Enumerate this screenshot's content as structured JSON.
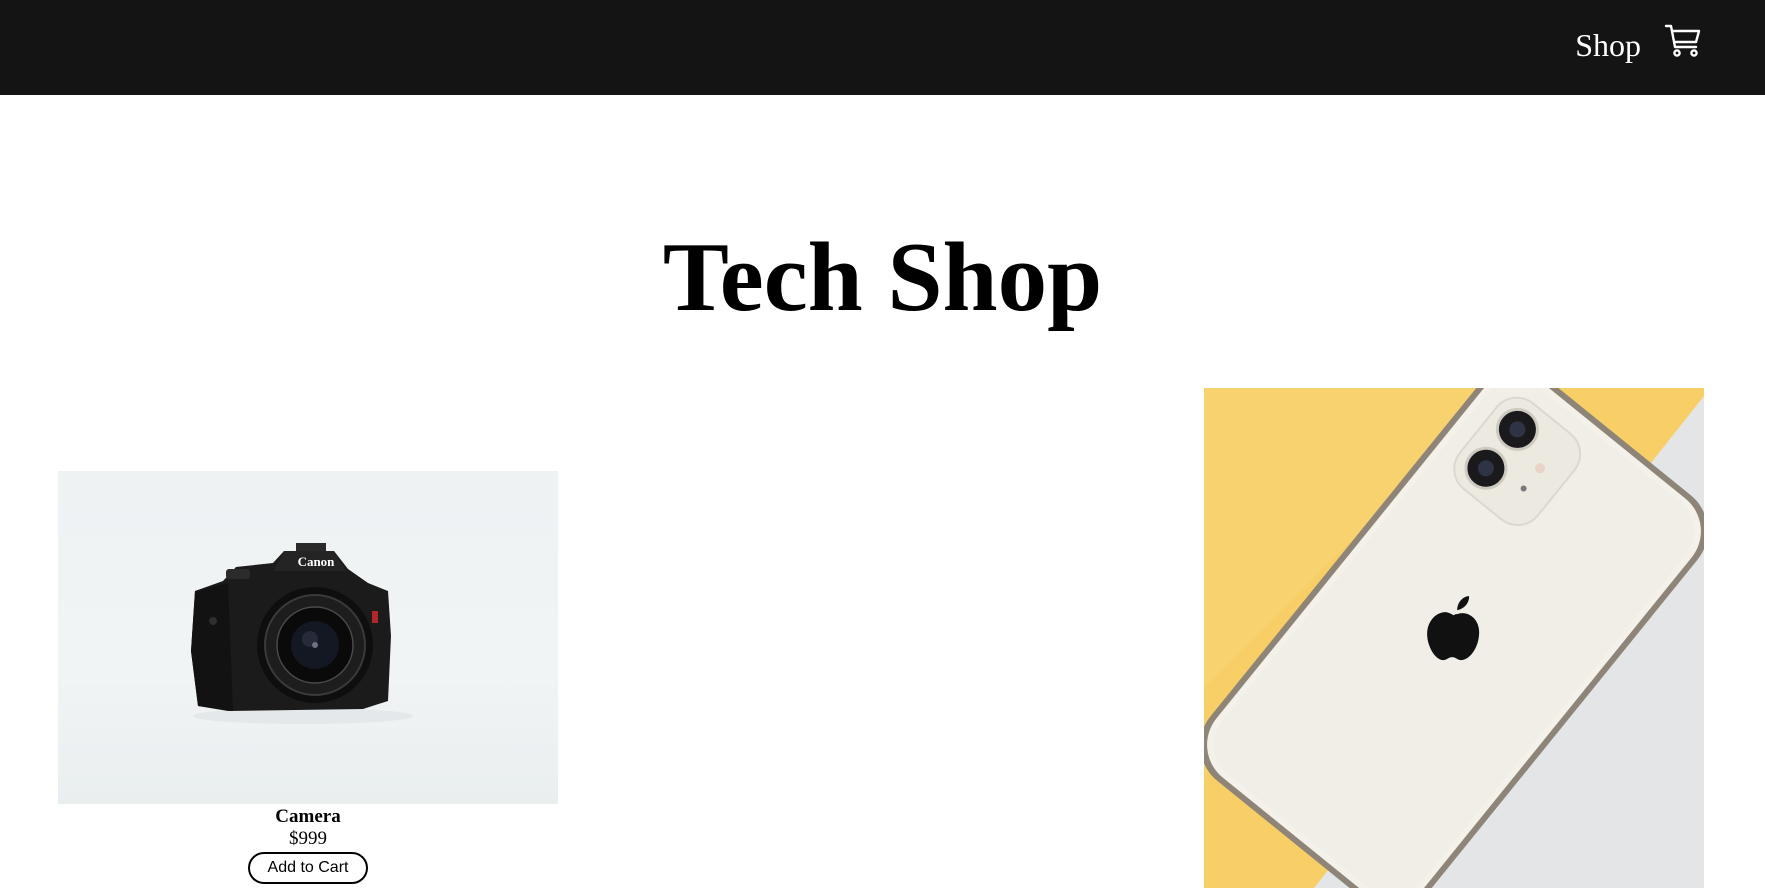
{
  "header": {
    "nav_shop_label": "Shop",
    "cart_icon": "cart-icon"
  },
  "main": {
    "title": "Tech Shop"
  },
  "products": [
    {
      "name": "Camera",
      "price": "$999",
      "button_label": "Add to Cart",
      "image_icon": "camera-photo",
      "brand_text": "Canon"
    },
    {
      "name": "",
      "price": "",
      "button_label": "",
      "image_icon": "smartphone-photo"
    }
  ],
  "colors": {
    "header_bg": "#141414",
    "phone_bg_yellow": "#f8cf67",
    "phone_bg_grey": "#e4e5e7"
  }
}
